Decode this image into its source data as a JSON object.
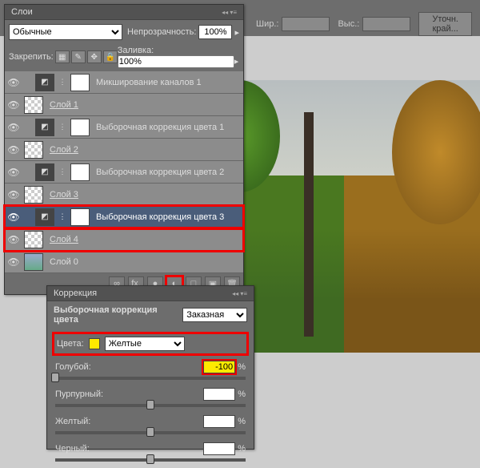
{
  "topbar": {
    "w_label": "Шир.:",
    "h_label": "Выс.:",
    "refine": "Уточн. край..."
  },
  "layers_panel": {
    "title": "Слои",
    "blend_mode": "Обычные",
    "opacity_label": "Непрозрачность:",
    "opacity": "100%",
    "lock_label": "Закрепить:",
    "fill_label": "Заливка:",
    "fill": "100%",
    "layers": [
      {
        "name": "Микширование каналов 1",
        "type": "adj"
      },
      {
        "name": "Слой 1",
        "type": "checker",
        "u": true
      },
      {
        "name": "Выборочная коррекция цвета 1",
        "type": "adj"
      },
      {
        "name": "Слой 2",
        "type": "checker",
        "u": true
      },
      {
        "name": "Выборочная коррекция цвета 2",
        "type": "adj"
      },
      {
        "name": "Слой 3",
        "type": "checker",
        "u": true
      },
      {
        "name": "Выборочная коррекция цвета 3",
        "type": "adj",
        "selected": true
      },
      {
        "name": "Слой 4",
        "type": "checker",
        "u": true
      },
      {
        "name": "Слой 0",
        "type": "img"
      }
    ],
    "footer_icons": [
      "∞",
      "fx.",
      "●",
      "◐",
      "□",
      "▣",
      "🗑"
    ]
  },
  "correction_panel": {
    "title": "Коррекция",
    "subtitle": "Выборочная коррекция цвета",
    "preset": "Заказная",
    "colors_label": "Цвета:",
    "color_selected": "Желтые",
    "sliders": [
      {
        "label": "Голубой:",
        "value": "-100",
        "handle": 0,
        "hl": true
      },
      {
        "label": "Пурпурный:",
        "value": "",
        "handle": 50
      },
      {
        "label": "Желтый:",
        "value": "",
        "handle": 50
      },
      {
        "label": "Черный:",
        "value": "",
        "handle": 50
      }
    ],
    "pct": "%"
  }
}
